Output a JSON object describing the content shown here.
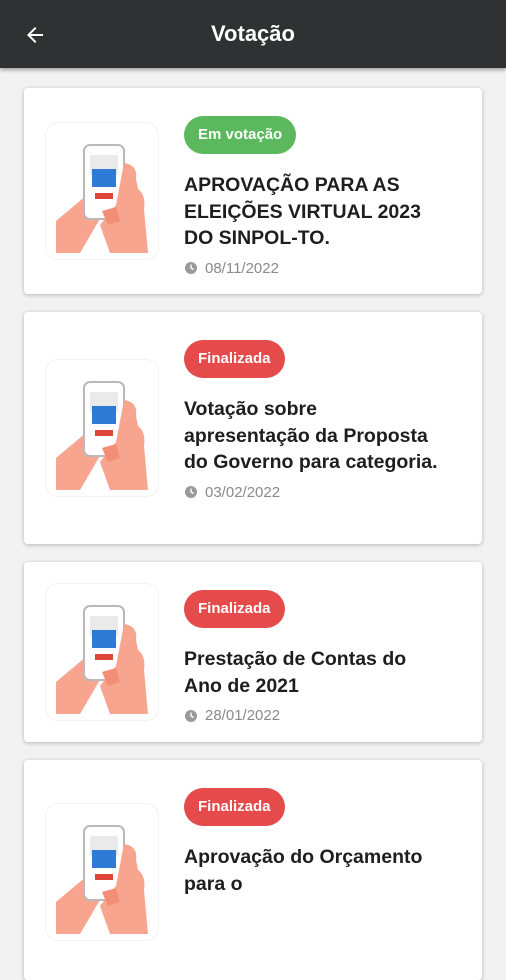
{
  "header": {
    "title": "Votação",
    "back_icon": "arrow-left-icon"
  },
  "colors": {
    "open": "#5cb85c",
    "closed": "#e54b4b",
    "appbar": "#2f3133"
  },
  "votes": [
    {
      "status": "Em votação",
      "title": "APROVAÇÃO PARA AS ELEIÇÕES VIRTUAL 2023 DO SINPOL-TO.",
      "date": "08/11/2022"
    },
    {
      "status": "Finalizada",
      "title": "Votação sobre apresentação da Proposta do Governo para categoria.",
      "date": "03/02/2022"
    },
    {
      "status": "Finalizada",
      "title": "Prestação de Contas do Ano de 2021",
      "date": "28/01/2022"
    },
    {
      "status": "Finalizada",
      "title": "Aprovação do Orçamento para o",
      "date": ""
    }
  ]
}
